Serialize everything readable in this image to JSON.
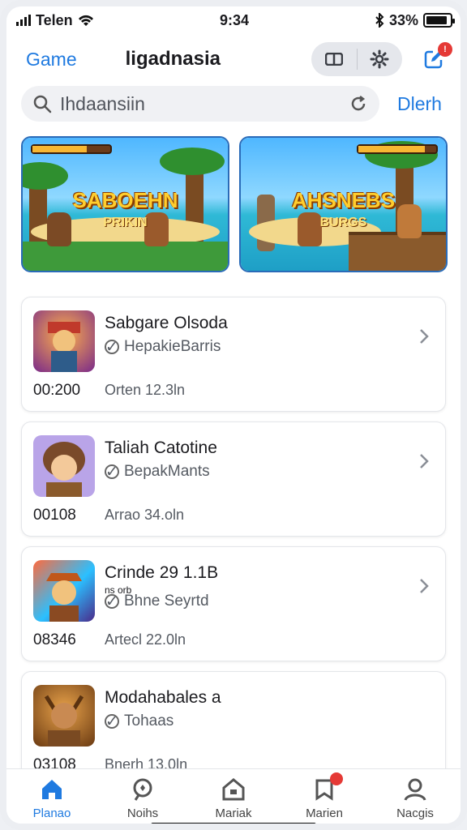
{
  "status": {
    "carrier": "Telen",
    "time": "9:34",
    "battery": "33%"
  },
  "header": {
    "back_label": "Game",
    "title": "ligadnasia"
  },
  "search": {
    "query": "Ihdaansiin",
    "action": "Dlerh"
  },
  "banners": [
    {
      "title": "SABOEHN",
      "subtitle": "PRIKIN"
    },
    {
      "title": "AHSNEBS",
      "subtitle": "BURGS"
    }
  ],
  "apps": [
    {
      "name": "Sabgare Olsoda",
      "developer": "HepakieBarris",
      "code": "00:200",
      "meta": "Orten 12.3ln",
      "extra": ""
    },
    {
      "name": "Taliah Catotine",
      "developer": "BepakMants",
      "code": "00108",
      "meta": "Arrao 34.oln",
      "extra": ""
    },
    {
      "name": "Crinde 29 1.1B",
      "developer": "Bhne Seyrtd",
      "code": "08346",
      "meta": "Artecl 22.0ln",
      "extra": "ns orb"
    },
    {
      "name": "Modahabales a",
      "developer": "Tohaas",
      "code": "03108",
      "meta": "Bnerh 13.0ln",
      "extra": ""
    }
  ],
  "tabs": [
    {
      "label": "Planao",
      "icon": "home-icon"
    },
    {
      "label": "Noihs",
      "icon": "search-icon"
    },
    {
      "label": "Mariak",
      "icon": "store-icon"
    },
    {
      "label": "Marien",
      "icon": "bookmark-icon"
    },
    {
      "label": "Nacgis",
      "icon": "profile-icon"
    }
  ],
  "colors": {
    "accent": "#1f7ae0",
    "badge": "#e53935"
  }
}
